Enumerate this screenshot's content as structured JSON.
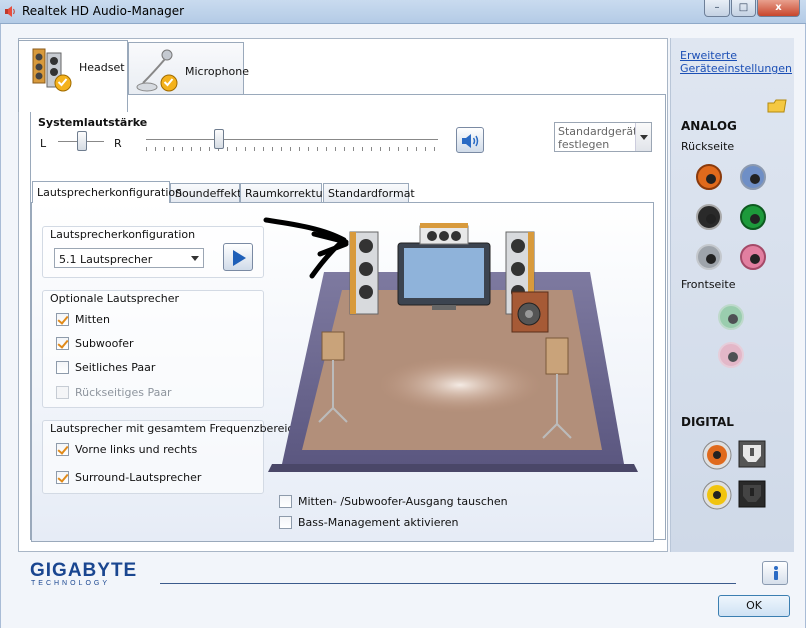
{
  "window": {
    "title": "Realtek HD Audio-Manager",
    "minimize": "–",
    "maximize": "□",
    "close": "x"
  },
  "device_tabs": [
    {
      "label": "Headset"
    },
    {
      "label": "Microphone"
    }
  ],
  "volume": {
    "title": "Systemlautstärke",
    "left": "L",
    "right": "R",
    "balance_level": 0.5,
    "master_level": 0.25
  },
  "default_device": {
    "line1": "Standardgerät",
    "line2": "festlegen"
  },
  "sub_tabs": [
    {
      "label": "Lautsprecherkonfiguration"
    },
    {
      "label": "Soundeffekt"
    },
    {
      "label": "Raumkorrektur"
    },
    {
      "label": "Standardformat"
    }
  ],
  "speaker_config": {
    "title": "Lautsprecherkonfiguration",
    "selected": "5.1 Lautsprecher"
  },
  "optional_speakers": {
    "title": "Optionale Lautsprecher",
    "items": [
      {
        "label": "Mitten",
        "checked": true,
        "disabled": false
      },
      {
        "label": "Subwoofer",
        "checked": true,
        "disabled": false
      },
      {
        "label": "Seitliches Paar",
        "checked": false,
        "disabled": false
      },
      {
        "label": "Rückseitiges Paar",
        "checked": false,
        "disabled": true
      }
    ]
  },
  "fullrange": {
    "title": "Lautsprecher mit gesamtem Frequenzbereich",
    "items": [
      {
        "label": "Vorne links und rechts",
        "checked": true
      },
      {
        "label": "Surround-Lautsprecher",
        "checked": true
      }
    ]
  },
  "bottom_options": [
    {
      "label": "Mitten- /Subwoofer-Ausgang tauschen",
      "checked": false
    },
    {
      "label": "Bass-Management aktivieren",
      "checked": false
    }
  ],
  "right_panel": {
    "link_line1": "Erweiterte",
    "link_line2": "Geräteeinstellungen",
    "analog": "ANALOG",
    "rear": "Rückseite",
    "front": "Frontseite",
    "digital": "DIGITAL",
    "jack_colors": {
      "orange": "#e06a1c",
      "blue": "#6f8fc6",
      "black": "#2a2a2a",
      "green": "#1d9a3b",
      "gray": "#9ea4ab",
      "pink": "#e27fa0"
    }
  },
  "footer": {
    "brand": "GIGABYTE",
    "brand_sub": "TECHNOLOGY",
    "ok": "OK"
  }
}
